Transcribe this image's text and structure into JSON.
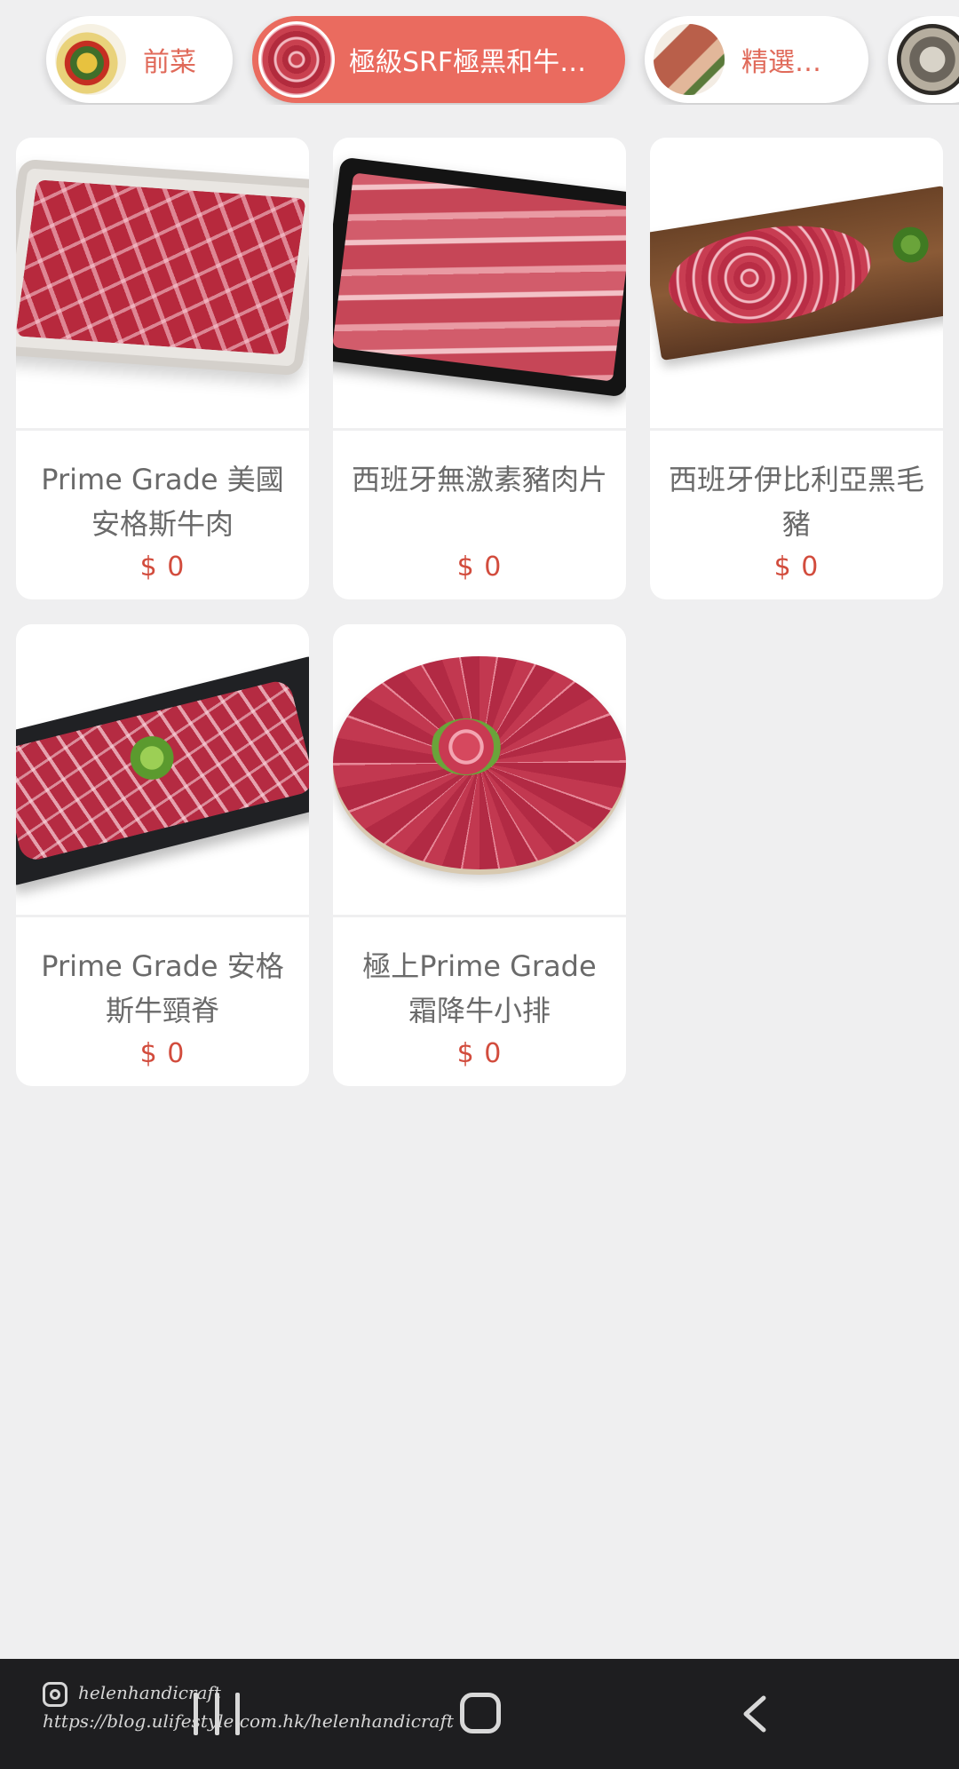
{
  "colors": {
    "accent": "#ea6b5f",
    "price": "#d24c3d",
    "background": "#efeff0",
    "navbar": "#1e1e20"
  },
  "categories": [
    {
      "label": "前菜",
      "icon": "appetizer-thumbnail",
      "active": false
    },
    {
      "label": "極級SRF極黑和牛肩…",
      "icon": "wagyu-thumbnail",
      "active": true
    },
    {
      "label": "精選肉類",
      "icon": "meats-thumbnail",
      "active": false
    },
    {
      "label": "",
      "icon": "oyster-thumbnail",
      "active": false
    }
  ],
  "products": [
    {
      "name": "Prime Grade 美國安格斯牛肉",
      "price": "$ 0",
      "image": "beef-slices-white-tray"
    },
    {
      "name": "西班牙無激素豬肉片",
      "price": "$ 0",
      "image": "pork-slices-black-tray"
    },
    {
      "name": "西班牙伊比利亞黑毛豬",
      "price": "$ 0",
      "image": "iberico-pork-wood-board"
    },
    {
      "name": "Prime Grade 安格斯牛頸脊",
      "price": "$ 0",
      "image": "beef-chuck-slate-board"
    },
    {
      "name": "極上Prime Grade霜降牛小排",
      "price": "$ 0",
      "image": "marbled-short-rib-round-plate"
    }
  ],
  "navbar": {
    "watermark_handle": "helenhandicraft",
    "watermark_url": "https://blog.ulifestyle.com.hk/helenhandicraft",
    "icons": [
      "recent-apps-icon",
      "home-icon",
      "back-icon"
    ]
  }
}
